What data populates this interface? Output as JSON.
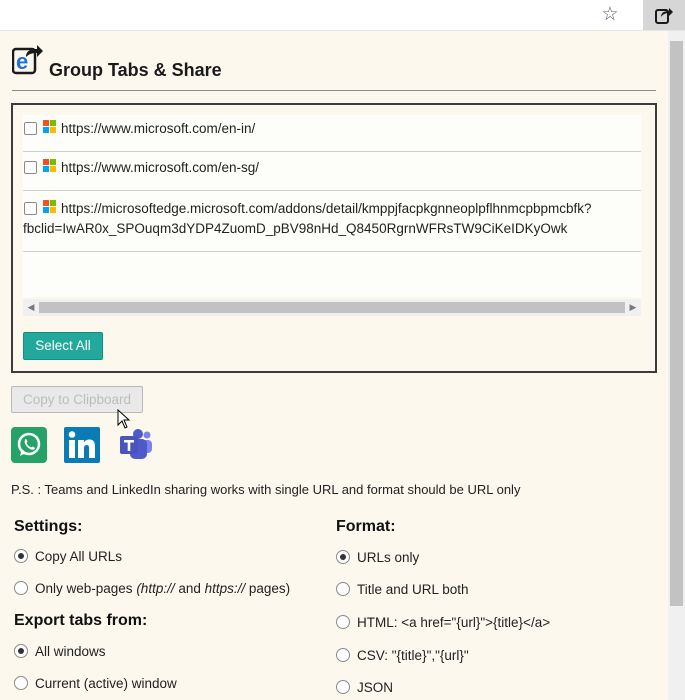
{
  "app": {
    "title": "Group Tabs & Share"
  },
  "urls": [
    {
      "url": "https://www.microsoft.com/en-in/",
      "checked": false
    },
    {
      "url": "https://www.microsoft.com/en-sg/",
      "checked": false
    },
    {
      "url_line1": "https://microsoftedge.microsoft.com/addons/detail/kmppjfacpkgnneoplpflhnmcpbpmcbfk?",
      "url_line2": "fbclid=IwAR0x_SPOuqm3dYDP4ZuomD_pBV98nHd_Q8450RgrnWFRsTW9CiKeIDKyOwk",
      "checked": false
    }
  ],
  "buttons": {
    "select_all": "Select All",
    "copy": "Copy to Clipboard"
  },
  "share": {
    "icons": [
      "whatsapp-icon",
      "linkedin-icon",
      "teams-icon"
    ]
  },
  "note": "P.S. : Teams and LinkedIn sharing works with single URL and format should be URL only",
  "settings": {
    "heading": "Settings:",
    "opt1": "Copy All URLs",
    "opt2_a": "Only web-pages ",
    "opt2_b": "(http://",
    "opt2_c": " and ",
    "opt2_d": "https://",
    "opt2_e": " pages)",
    "selected": "Copy All URLs"
  },
  "export": {
    "heading": "Export tabs from:",
    "opt1": "All windows",
    "opt2": "Current (active) window",
    "selected": "All windows"
  },
  "format": {
    "heading": "Format:",
    "opt1": "URLs only",
    "opt2": "Title and URL both",
    "opt3": "HTML: <a href=\"{url}\">{title}</a>",
    "opt4": "CSV: \"{title}\",\"{url}\"",
    "opt5": "JSON",
    "selected": "URLs only"
  },
  "colors": {
    "accent": "#22a99b",
    "background": "#fdf8ee"
  }
}
